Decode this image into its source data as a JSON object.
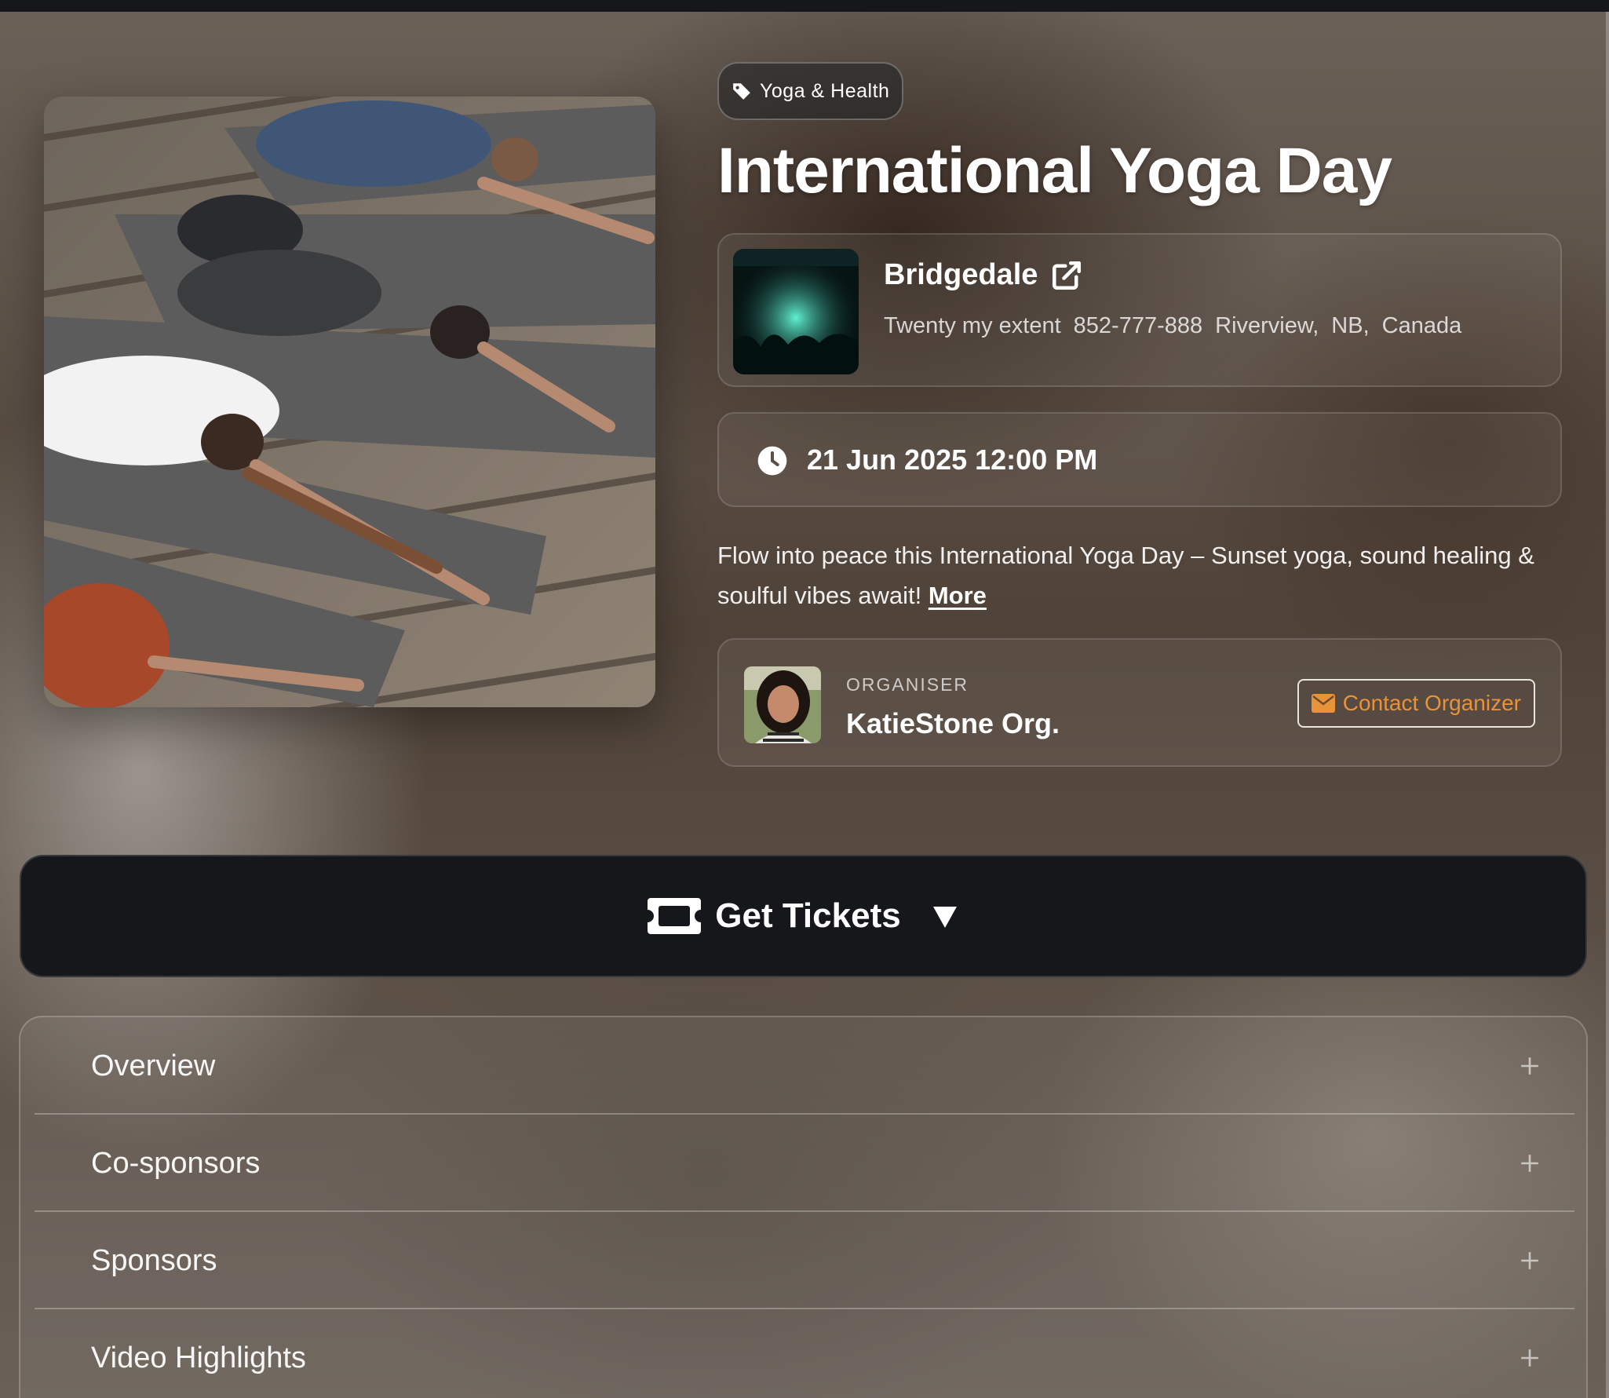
{
  "event": {
    "category": "Yoga & Health",
    "title": "International Yoga Day",
    "description": "Flow into peace this International Yoga Day – Sunset yoga, sound healing & soulful vibes await!",
    "more_label": "More"
  },
  "venue": {
    "name": "Bridgedale",
    "address": {
      "street": "Twenty my extent",
      "phone": "852-777-888",
      "city": "Riverview,",
      "province": "NB,",
      "country": "Canada"
    }
  },
  "datetime": "21 Jun 2025 12:00 PM",
  "organiser": {
    "label": "ORGANISER",
    "name": "KatieStone Org.",
    "contact_label": "Contact Organizer"
  },
  "tickets": {
    "label": "Get Tickets"
  },
  "accordion": {
    "items": [
      {
        "label": "Overview"
      },
      {
        "label": "Co-sponsors"
      },
      {
        "label": "Sponsors"
      },
      {
        "label": "Video Highlights"
      }
    ]
  },
  "colors": {
    "accent": "#e8923a",
    "dark_bar": "#15171b"
  },
  "icons": {
    "category": "tag-icon",
    "venue_link": "external-link-icon",
    "time": "clock-icon",
    "contact": "mail-icon",
    "tickets": "ticket-icon",
    "tickets_toggle": "caret-down-icon",
    "accordion_toggle": "plus-icon"
  }
}
